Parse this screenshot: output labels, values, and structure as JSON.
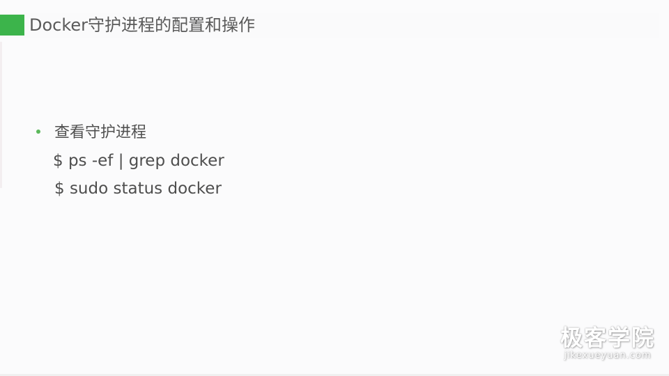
{
  "slide": {
    "title": "Docker守护进程的配置和操作",
    "accent_color": "#3cb44b",
    "bullets": [
      {
        "text": "查看守护进程",
        "bullet_color": "#5cb85c"
      }
    ],
    "commands": [
      "$ ps -ef | grep docker",
      "$ sudo status docker"
    ]
  },
  "watermark": {
    "brand": "极客学院",
    "url": "jikexueyuan.com"
  }
}
